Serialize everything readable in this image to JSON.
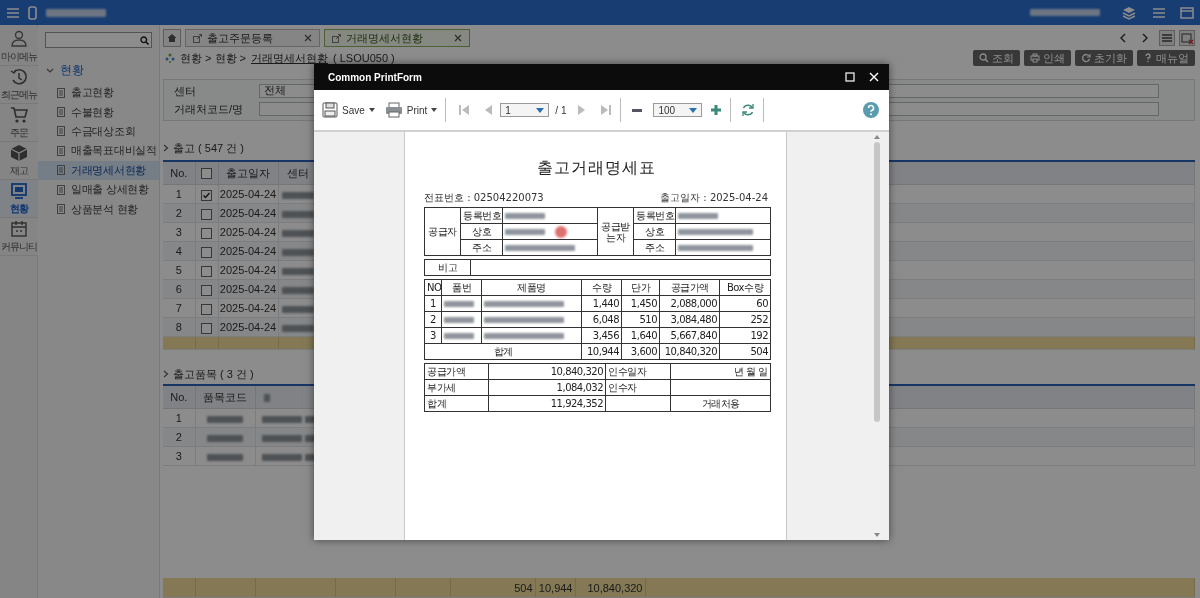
{
  "icon_rail": [
    {
      "label": "마이메뉴",
      "selected": false
    },
    {
      "label": "최근메뉴",
      "selected": false
    },
    {
      "label": "주문",
      "selected": false
    },
    {
      "label": "재고",
      "selected": false
    },
    {
      "label": "현황",
      "selected": true
    },
    {
      "label": "커뮤니티",
      "selected": false
    }
  ],
  "menu": {
    "group": {
      "label": "현황",
      "expanded": true,
      "children": [
        {
          "label": "출고현황",
          "selected": false
        },
        {
          "label": "수불현황",
          "selected": false
        },
        {
          "label": "수금대상조회",
          "selected": false
        },
        {
          "label": "매출목표대비실적",
          "selected": false
        },
        {
          "label": "거래명세서현황",
          "selected": true
        },
        {
          "label": "일매출 상세현황",
          "selected": false
        },
        {
          "label": "상품분석 현황",
          "selected": false
        }
      ]
    }
  },
  "tabs": [
    {
      "label": "출고주문등록",
      "selected": false
    },
    {
      "label": "거래명세서현황",
      "selected": true
    }
  ],
  "breadcrumb": {
    "path": "현황 > 현황 >",
    "link": "거래명세서현황",
    "code": "( LSOU050 )"
  },
  "actions": [
    "조회",
    "인쇄",
    "초기화",
    "매뉴얼"
  ],
  "filters": [
    {
      "label": "센터",
      "value": "전체"
    },
    {
      "label": "거래처코드/명"
    }
  ],
  "shipments": {
    "title": "출고 ( 547 건 )",
    "columns": [
      "No.",
      "출고일자",
      "센터"
    ],
    "header_checked": false,
    "rows": [
      {
        "no": "1",
        "checked": true,
        "date": "2025-04-24"
      },
      {
        "no": "2",
        "checked": false,
        "date": "2025-04-24"
      },
      {
        "no": "3",
        "checked": false,
        "date": "2025-04-24"
      },
      {
        "no": "4",
        "checked": false,
        "date": "2025-04-24"
      },
      {
        "no": "5",
        "checked": false,
        "date": "2025-04-24"
      },
      {
        "no": "6",
        "checked": false,
        "date": "2025-04-24"
      },
      {
        "no": "7",
        "checked": false,
        "date": "2025-04-24"
      },
      {
        "no": "8",
        "checked": false,
        "date": "2025-04-24"
      }
    ]
  },
  "shipment_items": {
    "title": "출고품목 ( 3 건 )",
    "columns": [
      "No.",
      "품목코드"
    ],
    "rows": [
      {
        "no": "1"
      },
      {
        "no": "2"
      },
      {
        "no": "3"
      }
    ],
    "totals": [
      "504",
      "10,944",
      "10,840,320"
    ]
  },
  "print_dialog": {
    "title": "Common PrintForm",
    "toolbar": {
      "save": "Save",
      "print": "Print",
      "page": "1",
      "page_total": "/ 1",
      "zoom": "100"
    },
    "document": {
      "title": "출고거래명세표",
      "slip_no": "전표번호 : 02504220073",
      "ship_date": "출고일자 : 2025-04-24",
      "supplier": {
        "label": "공급자",
        "fields": [
          "등록번호",
          "상호",
          "주소"
        ]
      },
      "receiver": {
        "label": "공급받는자",
        "fields": [
          "등록번호",
          "상호",
          "주소"
        ]
      },
      "remark_label": "비고",
      "columns": [
        "NO",
        "품번",
        "제품명",
        "수량",
        "단가",
        "공급가액",
        "Box수량"
      ],
      "rows": [
        {
          "no": "1",
          "qty": "1,440",
          "price": "1,450",
          "amount": "2,088,000",
          "boxes": "60"
        },
        {
          "no": "2",
          "qty": "6,048",
          "price": "510",
          "amount": "3,084,480",
          "boxes": "252"
        },
        {
          "no": "3",
          "qty": "3,456",
          "price": "1,640",
          "amount": "5,667,840",
          "boxes": "192"
        }
      ],
      "total": {
        "label": "합계",
        "qty": "10,944",
        "price": "3,600",
        "amount": "10,840,320",
        "boxes": "504"
      },
      "summary": [
        {
          "label": "공급가액",
          "value": "10,840,320",
          "label2": "인수일자",
          "value2": "년 월 일"
        },
        {
          "label": "부가세",
          "value": "1,084,032",
          "label2": "인수자"
        },
        {
          "label": "합계",
          "value": "11,924,352",
          "value2": "거래처용"
        }
      ]
    }
  }
}
